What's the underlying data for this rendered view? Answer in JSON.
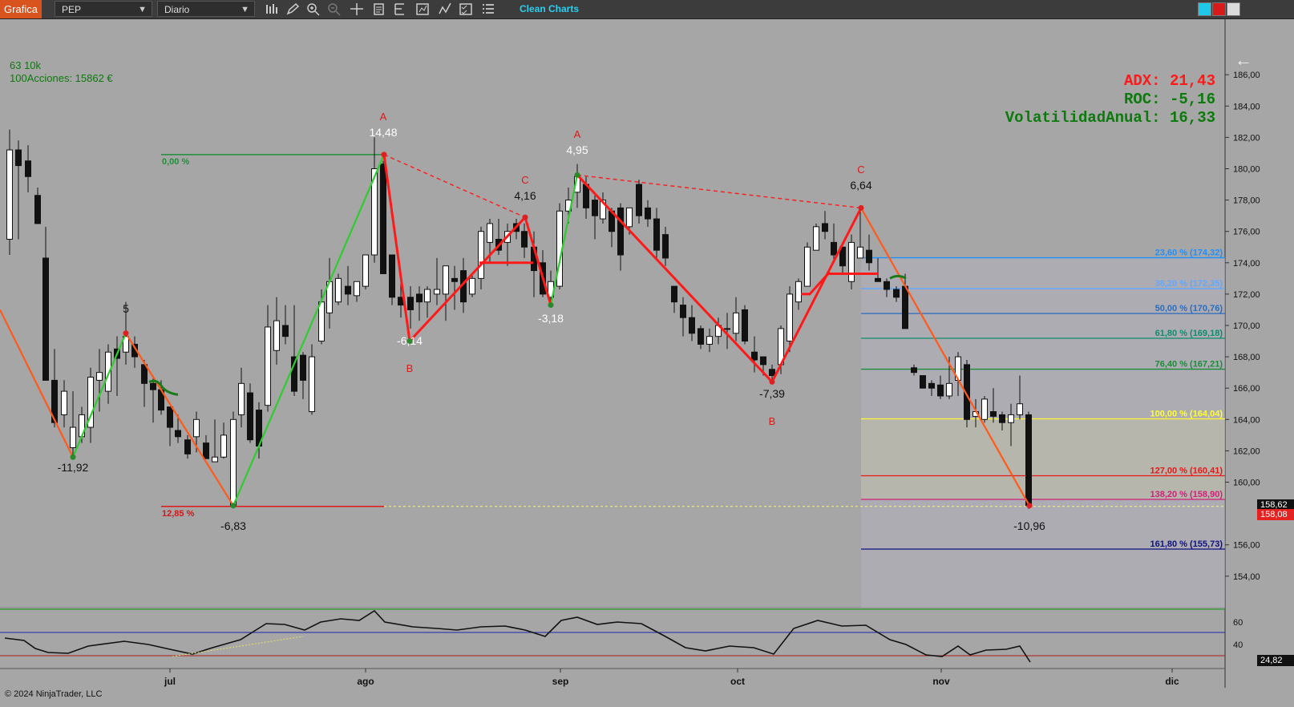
{
  "toolbar": {
    "app_tab": "Grafica",
    "instrument": "PEP",
    "period": "Diario",
    "clean_charts": "Clean Charts"
  },
  "info": {
    "line1": "63 10k",
    "line2": "100Acciones: 15862 €"
  },
  "indicators": {
    "adx": "ADX: 21,43",
    "roc": "ROC: -5,16",
    "vol": "VolatilidadAnual: 16,33"
  },
  "colors": {
    "background": "#a6a6a6",
    "up_leg": "#2ecc2e",
    "down_leg": "#ff5a1a",
    "zigzag": "#ff1a1a",
    "adx_text": "#ff1a1a",
    "green_text": "#0c7a0c"
  },
  "price_axis": [
    "186,00",
    "184,00",
    "182,00",
    "180,00",
    "178,00",
    "176,00",
    "174,00",
    "172,00",
    "170,00",
    "168,00",
    "166,00",
    "164,00",
    "162,00",
    "160,00",
    "156,00",
    "154,00"
  ],
  "last_price": "158,62",
  "last_price_2": "158,08",
  "time_axis": [
    "jul",
    "ago",
    "sep",
    "oct",
    "nov",
    "dic"
  ],
  "osc_axis": [
    "60",
    "40"
  ],
  "osc_last": "24,82",
  "fibs": [
    {
      "label": "23,60 % (174,32)",
      "price": 174.32,
      "color": "#1e90ff"
    },
    {
      "label": "38,20 % (172,35)",
      "price": 172.35,
      "color": "#63a8ff"
    },
    {
      "label": "50,00 % (170,76)",
      "price": 170.76,
      "color": "#2a6cc0"
    },
    {
      "label": "61,80 % (169,18)",
      "price": 169.18,
      "color": "#0f8c6e"
    },
    {
      "label": "76,40 % (167,21)",
      "price": 167.21,
      "color": "#1c8c3a"
    },
    {
      "label": "100,00 % (164,04)",
      "price": 164.04,
      "color": "#ffff33"
    },
    {
      "label": "127,00 % (160,41)",
      "price": 160.41,
      "color": "#e81818"
    },
    {
      "label": "138,20 % (158,90)",
      "price": 158.9,
      "color": "#d0207a"
    },
    {
      "label": "161,80 % (155,73)",
      "price": 155.73,
      "color": "#101080"
    }
  ],
  "left_fib": {
    "top": "0,00 %",
    "bottom": "12,85 %"
  },
  "pivots": [
    {
      "label": "-11,92"
    },
    {
      "label": "5"
    },
    {
      "label": "-6,83"
    },
    {
      "label": "14,48"
    },
    {
      "label": "-6,14"
    },
    {
      "label": "4,16"
    },
    {
      "label": "-3,18"
    },
    {
      "label": "4,95"
    },
    {
      "label": "-7,39"
    },
    {
      "label": "6,64"
    },
    {
      "label": "-10,96"
    }
  ],
  "abc_letters": [
    "A",
    "B",
    "C",
    "A",
    "B",
    "C"
  ],
  "copyright": "© 2024 NinjaTrader, LLC",
  "candles": [
    [
      12,
      182.5,
      174.5,
      175.5,
      181.2
    ],
    [
      23,
      181.8,
      175.5,
      181.2,
      180.2
    ],
    [
      35,
      181.5,
      178.5,
      180.5,
      179.5
    ],
    [
      47,
      178.8,
      176.5,
      178.3,
      176.5
    ],
    [
      57,
      176.3,
      166.5,
      174.3,
      166.5
    ],
    [
      68,
      168.5,
      163.5,
      166.5,
      163.8
    ],
    [
      80,
      166.5,
      163.5,
      164.3,
      165.8
    ],
    [
      91,
      165.8,
      161.5,
      162.2,
      163.5
    ],
    [
      102,
      164.8,
      162.5,
      162.9,
      164.3
    ],
    [
      113,
      167.3,
      162.5,
      163.5,
      166.7
    ],
    [
      124,
      168.5,
      164.5,
      166.5,
      167.0
    ],
    [
      135,
      168.8,
      165.0,
      165.8,
      168.3
    ],
    [
      146,
      169.3,
      165.5,
      168.5,
      167.9
    ],
    [
      157,
      171.5,
      167.5,
      168.3,
      169.3
    ],
    [
      168,
      169.3,
      167.3,
      168.8,
      168.0
    ],
    [
      180,
      167.8,
      164.8,
      167.5,
      166.3
    ],
    [
      191,
      166.8,
      163.8,
      166.3,
      165.9
    ],
    [
      201,
      166.5,
      164.3,
      165.9,
      164.6
    ],
    [
      212,
      164.8,
      162.3,
      164.8,
      163.5
    ],
    [
      222,
      164.3,
      162.5,
      163.3,
      162.9
    ],
    [
      234,
      163.0,
      161.5,
      162.7,
      161.8
    ],
    [
      245,
      164.5,
      161.9,
      162.9,
      164.0
    ],
    [
      257,
      163.0,
      161.5,
      162.5,
      161.5
    ],
    [
      268,
      164.0,
      161.3,
      161.3,
      161.6
    ],
    [
      279,
      163.8,
      161.5,
      161.6,
      163.0
    ],
    [
      291,
      164.5,
      158.5,
      158.5,
      164.0
    ],
    [
      301,
      167.3,
      163.5,
      164.3,
      166.3
    ],
    [
      312,
      166.3,
      162.5,
      165.7,
      162.7
    ],
    [
      323,
      165.1,
      161.5,
      164.6,
      162.3
    ],
    [
      334,
      171.3,
      164.5,
      164.9,
      169.9
    ],
    [
      345,
      171.8,
      167.5,
      168.4,
      170.3
    ],
    [
      356,
      171.3,
      168.8,
      170.0,
      169.3
    ],
    [
      367,
      171.3,
      165.5,
      168.0,
      165.8
    ],
    [
      378,
      168.3,
      165.3,
      168.1,
      166.5
    ],
    [
      389,
      168.8,
      164.3,
      164.5,
      168.0
    ],
    [
      401,
      172.3,
      168.8,
      169.0,
      171.5
    ],
    [
      411,
      174.3,
      169.8,
      170.8,
      172.8
    ],
    [
      422,
      173.3,
      171.3,
      171.5,
      173.0
    ],
    [
      434,
      173.8,
      171.3,
      172.5,
      172.0
    ],
    [
      445,
      172.8,
      171.5,
      171.9,
      172.8
    ],
    [
      456,
      173.8,
      172.3,
      172.5,
      174.5
    ],
    [
      467,
      182.0,
      174.0,
      174.5,
      180.0
    ],
    [
      478,
      180.5,
      175.5,
      180.3,
      173.3
    ],
    [
      489,
      174.5,
      171.3,
      174.5,
      171.8
    ],
    [
      500,
      173.3,
      170.5,
      171.8,
      171.3
    ],
    [
      512,
      172.5,
      169.8,
      171.8,
      171.0
    ],
    [
      523,
      172.5,
      170.3,
      172.0,
      171.5
    ],
    [
      533,
      172.5,
      170.5,
      171.5,
      172.3
    ],
    [
      545,
      174.3,
      171.3,
      172.0,
      172.3
    ],
    [
      556,
      172.8,
      170.3,
      172.0,
      173.8
    ],
    [
      567,
      173.8,
      171.0,
      173.0,
      172.8
    ],
    [
      578,
      174.3,
      170.8,
      173.5,
      171.5
    ],
    [
      589,
      173.3,
      171.8,
      172.0,
      173.0
    ],
    [
      600,
      176.3,
      172.3,
      173.0,
      176.0
    ],
    [
      611,
      176.8,
      174.0,
      175.3,
      176.5
    ],
    [
      622,
      176.8,
      174.5,
      175.5,
      174.8
    ],
    [
      633,
      176.5,
      173.8,
      175.3,
      176.0
    ],
    [
      644,
      176.8,
      175.5,
      176.5,
      176.0
    ],
    [
      654,
      176.5,
      174.3,
      176.0,
      175.0
    ],
    [
      666,
      176.0,
      171.8,
      175.0,
      173.5
    ],
    [
      677,
      174.8,
      171.8,
      174.0,
      172.0
    ],
    [
      687,
      173.5,
      171.3,
      171.8,
      172.8
    ],
    [
      698,
      177.8,
      172.3,
      172.5,
      177.3
    ],
    [
      709,
      178.8,
      176.5,
      177.3,
      178.0
    ],
    [
      720,
      180.3,
      177.5,
      178.5,
      179.5
    ],
    [
      731,
      179.5,
      176.8,
      179.0,
      177.5
    ],
    [
      742,
      178.3,
      175.5,
      178.0,
      177.0
    ],
    [
      752,
      178.5,
      176.5,
      176.8,
      178.0
    ],
    [
      763,
      177.5,
      175.0,
      177.3,
      176.0
    ],
    [
      774,
      177.8,
      173.5,
      177.5,
      174.5
    ],
    [
      785,
      177.5,
      175.8,
      176.3,
      177.5
    ],
    [
      797,
      179.3,
      176.5,
      179.0,
      177.0
    ],
    [
      808,
      178.0,
      176.3,
      177.5,
      176.8
    ],
    [
      819,
      177.5,
      174.3,
      176.8,
      174.8
    ],
    [
      830,
      176.3,
      173.8,
      175.8,
      174.3
    ],
    [
      841,
      172.5,
      170.8,
      172.5,
      171.5
    ],
    [
      852,
      171.8,
      169.3,
      171.3,
      170.5
    ],
    [
      863,
      171.3,
      169.0,
      170.5,
      169.5
    ],
    [
      874,
      170.0,
      168.5,
      169.8,
      168.8
    ],
    [
      885,
      169.8,
      168.3,
      168.8,
      169.3
    ],
    [
      896,
      170.5,
      168.8,
      169.3,
      170.0
    ],
    [
      907,
      170.8,
      168.5,
      169.8,
      169.8
    ],
    [
      918,
      171.8,
      169.0,
      169.5,
      170.8
    ],
    [
      929,
      171.3,
      168.8,
      171.0,
      169.0
    ],
    [
      941,
      169.3,
      167.0,
      168.3,
      167.8
    ],
    [
      952,
      168.0,
      166.8,
      168.0,
      167.5
    ],
    [
      963,
      167.5,
      166.5,
      167.2,
      166.8
    ],
    [
      974,
      170.0,
      166.9,
      167.5,
      169.8
    ],
    [
      985,
      172.5,
      168.3,
      169.0,
      172.0
    ],
    [
      996,
      173.0,
      171.0,
      171.5,
      172.8
    ],
    [
      1007,
      175.3,
      172.5,
      172.5,
      175.0
    ],
    [
      1018,
      176.5,
      174.8,
      174.8,
      176.3
    ],
    [
      1029,
      177.3,
      175.5,
      176.5,
      176.0
    ],
    [
      1040,
      176.5,
      174.0,
      175.3,
      174.5
    ],
    [
      1051,
      175.0,
      173.3,
      175.0,
      173.8
    ],
    [
      1062,
      175.8,
      172.3,
      172.8,
      175.3
    ],
    [
      1073,
      177.3,
      174.3,
      174.3,
      175.0
    ],
    [
      1084,
      175.8,
      173.5,
      174.8,
      174.0
    ],
    [
      1095,
      174.3,
      172.8,
      173.0,
      172.8
    ],
    [
      1106,
      173.0,
      171.8,
      172.8,
      172.3
    ],
    [
      1118,
      172.5,
      171.5,
      172.3,
      171.8
    ],
    [
      1129,
      173.3,
      169.8,
      172.5,
      169.8
    ],
    [
      1140,
      167.5,
      166.8,
      167.3,
      167.0
    ],
    [
      1151,
      166.8,
      166.0,
      166.8,
      166.0
    ],
    [
      1162,
      166.5,
      165.5,
      166.3,
      166.0
    ],
    [
      1173,
      166.8,
      165.3,
      166.2,
      165.5
    ],
    [
      1184,
      168.0,
      165.3,
      165.5,
      166.3
    ],
    [
      1195,
      168.3,
      165.5,
      166.5,
      168.0
    ],
    [
      1206,
      167.8,
      163.5,
      167.5,
      164.0
    ],
    [
      1217,
      165.3,
      163.5,
      164.2,
      164.5
    ],
    [
      1228,
      165.5,
      163.8,
      164.0,
      165.3
    ],
    [
      1239,
      166.0,
      163.8,
      164.5,
      164.2
    ],
    [
      1250,
      164.5,
      163.3,
      164.3,
      163.8
    ],
    [
      1261,
      165.0,
      162.3,
      163.8,
      164.3
    ],
    [
      1272,
      166.8,
      164.0,
      164.3,
      165.0
    ],
    [
      1283,
      164.5,
      158.3,
      164.3,
      158.5
    ]
  ]
}
